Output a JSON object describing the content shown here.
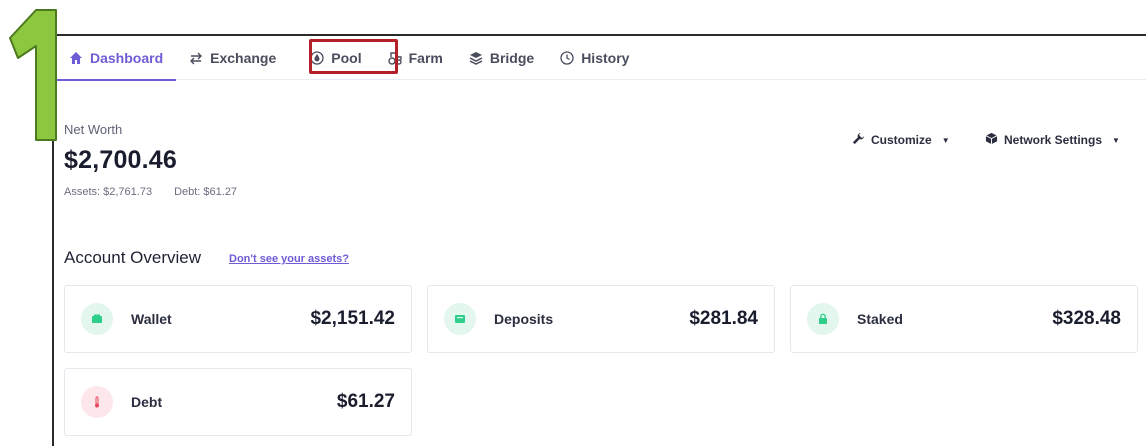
{
  "annotation": {
    "step": "1"
  },
  "nav": {
    "tabs": [
      {
        "label": "Dashboard",
        "icon": "home-icon"
      },
      {
        "label": "Exchange",
        "icon": "exchange-arrows-icon"
      },
      {
        "label": "Pool",
        "icon": "pool-drop-icon"
      },
      {
        "label": "Farm",
        "icon": "farm-icon"
      },
      {
        "label": "Bridge",
        "icon": "layers-icon"
      },
      {
        "label": "History",
        "icon": "clock-icon"
      }
    ],
    "active": "Dashboard",
    "highlighted": "Pool"
  },
  "net_worth": {
    "label": "Net Worth",
    "value": "$2,700.46",
    "assets": "Assets: $2,761.73",
    "debt": "Debt: $61.27"
  },
  "toolbar": {
    "customize": "Customize",
    "network_settings": "Network Settings"
  },
  "account_overview": {
    "title": "Account Overview",
    "link": "Don't see your assets?",
    "cards": [
      {
        "label": "Wallet",
        "value": "$2,151.42",
        "icon": "wallet-icon"
      },
      {
        "label": "Deposits",
        "value": "$281.84",
        "icon": "deposit-box-icon"
      },
      {
        "label": "Staked",
        "value": "$328.48",
        "icon": "lock-icon"
      },
      {
        "label": "Debt",
        "value": "$61.27",
        "icon": "thermometer-icon"
      }
    ]
  },
  "colors": {
    "accent": "#6e5bd6",
    "highlight_box": "#b3202a",
    "annotation_green": "#8dc63f",
    "positive_icon_bg": "#e3f7ee",
    "positive_icon": "#2ecf8a",
    "debt_icon_bg": "#fde7ea",
    "debt_icon": "#e8485c"
  }
}
